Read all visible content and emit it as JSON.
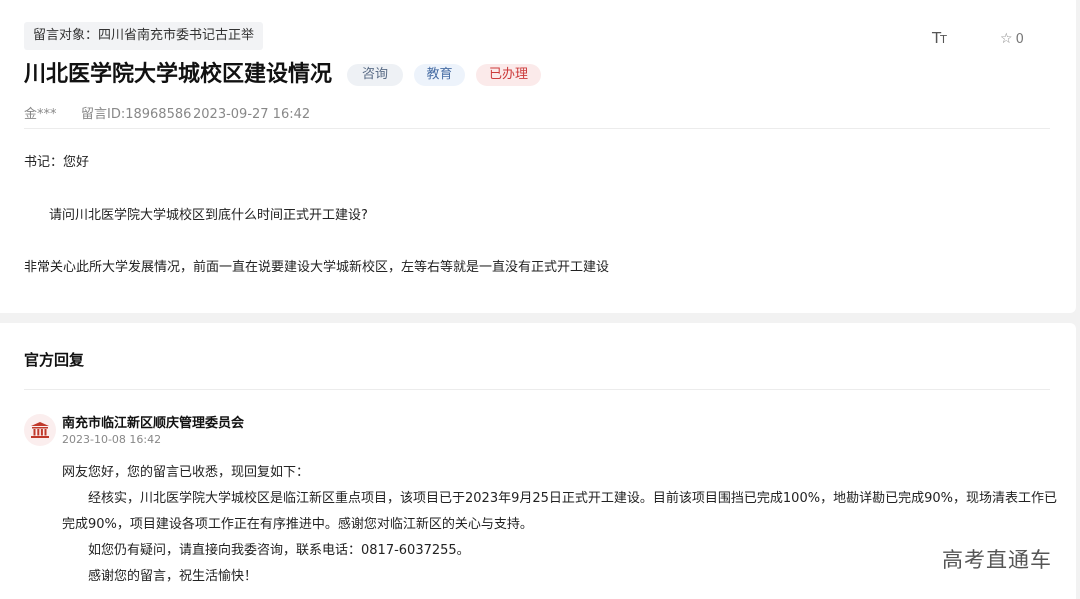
{
  "message": {
    "target": "留言对象：四川省南充市委书记古正举",
    "title": "川北医学院大学城校区建设情况",
    "tags": [
      "咨询",
      "教育",
      "已办理"
    ],
    "author": "金***",
    "message_id": "留言ID:18968586",
    "datetime": "2023-09-27 16:42",
    "paragraphs": [
      "书记：您好",
      "请问川北医学院大学城校区到底什么时间正式开工建设?",
      "非常关心此所大学发展情况，前面一直在说要建设大学城新校区，左等右等就是一直没有正式开工建设"
    ]
  },
  "toolbar": {
    "font_size_big": "T",
    "font_size_small": "T",
    "favorite_icon": "star-icon",
    "favorite_count": "0"
  },
  "reply": {
    "heading": "官方回复",
    "org_icon": "government-building-icon",
    "org_name": "南充市临江新区顺庆管理委员会",
    "datetime": "2023-10-08 16:42",
    "paragraphs": [
      "网友您好，您的留言已收悉，现回复如下：",
      "经核实，川北医学院大学城校区是临江新区重点项目，该项目已于2023年9月25日正式开工建设。目前该项目围挡已完成100%，地勘详勘已完成90%，现场清表工作已完成90%，项目建设各项工作正在有序推进中。感谢您对临江新区的关心与支持。",
      "如您仍有疑问，请直接向我委咨询，联系电话：0817-6037255。",
      "感谢您的留言，祝生活愉快！"
    ]
  },
  "watermark": "高考直通车",
  "colors": {
    "tag_consult": "#5a6c86",
    "tag_education": "#4a6fa5",
    "tag_handled": "#cc3b3b",
    "org_icon": "#c0392b"
  }
}
